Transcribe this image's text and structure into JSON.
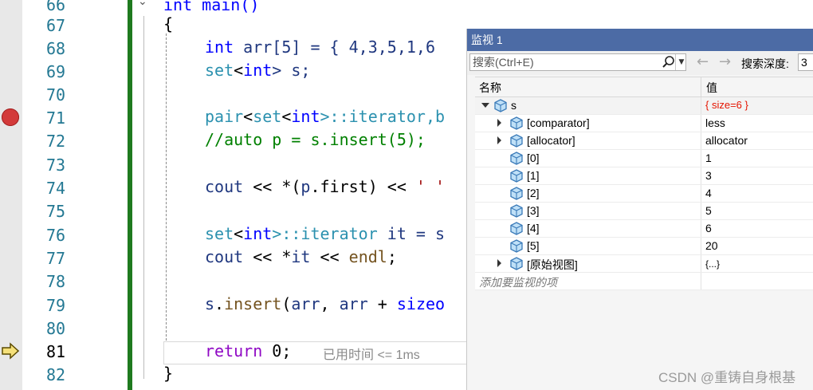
{
  "editor": {
    "line_numbers": [
      "66",
      "67",
      "68",
      "69",
      "70",
      "71",
      "72",
      "73",
      "74",
      "75",
      "76",
      "77",
      "78",
      "79",
      "80",
      "81",
      "82"
    ],
    "lines": {
      "l66": "int main()",
      "l67": "{",
      "l68": [
        "int",
        " arr[5] = { 4,3,5,1,6"
      ],
      "l69": [
        "set",
        "<",
        "int",
        "> s;"
      ],
      "l71": [
        "pair",
        "<",
        "set",
        "<",
        "int",
        ">::iterator,b"
      ],
      "l72": "//auto p = s.insert(5);",
      "l74": [
        "cout",
        " << *(",
        "p",
        ".first) << ",
        "' '"
      ],
      "l76": [
        "set",
        "<",
        "int",
        ">::iterator ",
        "it",
        " = s"
      ],
      "l77": [
        "cout",
        " << *",
        "it",
        " << ",
        "endl",
        ";"
      ],
      "l79": [
        "s",
        ".",
        "insert",
        "(",
        "arr",
        ", ",
        "arr",
        " + ",
        "sizeo"
      ],
      "l81": [
        "return",
        " 0;"
      ],
      "l82": "}"
    },
    "elapsed_hint": "已用时间 <= 1ms"
  },
  "watch": {
    "title": "监视 1",
    "search_placeholder": "搜索(Ctrl+E)",
    "depth_label": "搜索深度:",
    "depth_value": "3",
    "col_name": "名称",
    "col_value": "值",
    "rows": [
      {
        "name": "s",
        "value": "{ size=6 }"
      },
      {
        "name": "[comparator]",
        "value": "less"
      },
      {
        "name": "[allocator]",
        "value": "allocator"
      },
      {
        "name": "[0]",
        "value": "1"
      },
      {
        "name": "[1]",
        "value": "3"
      },
      {
        "name": "[2]",
        "value": "4"
      },
      {
        "name": "[3]",
        "value": "5"
      },
      {
        "name": "[4]",
        "value": "6"
      },
      {
        "name": "[5]",
        "value": "20"
      },
      {
        "name": "[原始视图]",
        "value": "{...}"
      }
    ],
    "add_item_placeholder": "添加要监视的项"
  },
  "watermark": "CSDN @重铸自身根基",
  "colors": {
    "title_bar": "#4c6ba5",
    "breakpoint": "#d33a3a",
    "change_bar": "#1f7a1f",
    "value_changed": "#e51400"
  }
}
